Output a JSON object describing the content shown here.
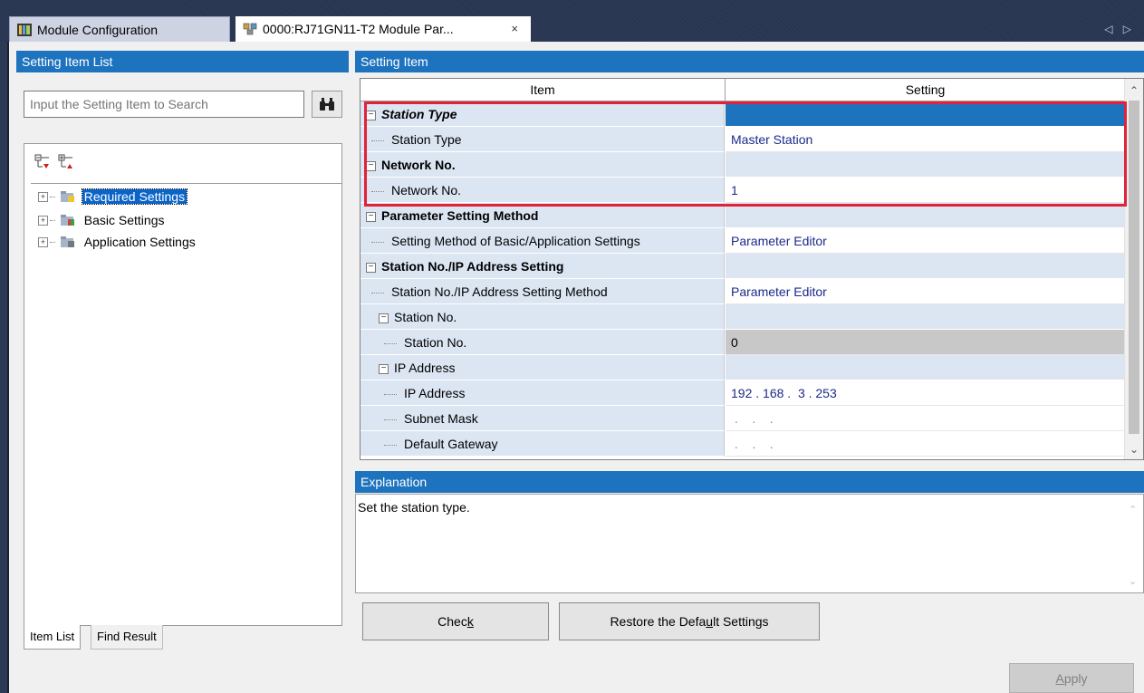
{
  "tabs": {
    "module_configuration": "Module Configuration",
    "module_parameter": "0000:RJ71GN11-T2 Module Par...",
    "close_symbol": "×",
    "nav_arrows": "◁ ▷"
  },
  "left_panel": {
    "header": "Setting Item List",
    "search_placeholder": "Input the Setting Item to Search",
    "tree": [
      {
        "label": "Required Settings",
        "selected": true
      },
      {
        "label": "Basic Settings",
        "selected": false
      },
      {
        "label": "Application Settings",
        "selected": false
      }
    ],
    "bottom_tabs": [
      "Item List",
      "Find Result"
    ]
  },
  "right_panel": {
    "header": "Setting Item",
    "columns": {
      "item": "Item",
      "setting": "Setting"
    },
    "rows": [
      {
        "item": "Station Type",
        "setting": "",
        "type": "group"
      },
      {
        "item": "Station Type",
        "setting": "Master Station",
        "type": "leaf"
      },
      {
        "item": "Network No.",
        "setting": "",
        "type": "group"
      },
      {
        "item": "Network No.",
        "setting": "1",
        "type": "leaf"
      },
      {
        "item": "Parameter Setting Method",
        "setting": "",
        "type": "group"
      },
      {
        "item": "Setting Method of Basic/Application Settings",
        "setting": "Parameter Editor",
        "type": "leaf"
      },
      {
        "item": "Station No./IP Address Setting",
        "setting": "",
        "type": "group"
      },
      {
        "item": "Station No./IP Address Setting Method",
        "setting": "Parameter Editor",
        "type": "leaf"
      },
      {
        "item": "Station No.",
        "setting": "",
        "type": "subgroup"
      },
      {
        "item": "Station No.",
        "setting": "0",
        "type": "subleaf"
      },
      {
        "item": "IP Address",
        "setting": "",
        "type": "subgroup"
      },
      {
        "item": "IP Address",
        "setting": "192 . 168 .  3 . 253",
        "type": "subleaf"
      },
      {
        "item": "Subnet Mask",
        "setting": " .    .    . ",
        "type": "subleaf"
      },
      {
        "item": "Default Gateway",
        "setting": " .    .    . ",
        "type": "subleaf"
      }
    ],
    "explanation_header": "Explanation",
    "explanation_text": "Set the station type."
  },
  "buttons": {
    "check_pre": "Chec",
    "check_key": "k",
    "restore_pre": "Restore the Defa",
    "restore_key": "u",
    "restore_post": "lt Settings",
    "apply_key": "A",
    "apply_post": "pply"
  },
  "colors": {
    "header_blue": "#1e73be",
    "highlight_red": "#e0233a",
    "setting_text": "#1c2a8a"
  }
}
